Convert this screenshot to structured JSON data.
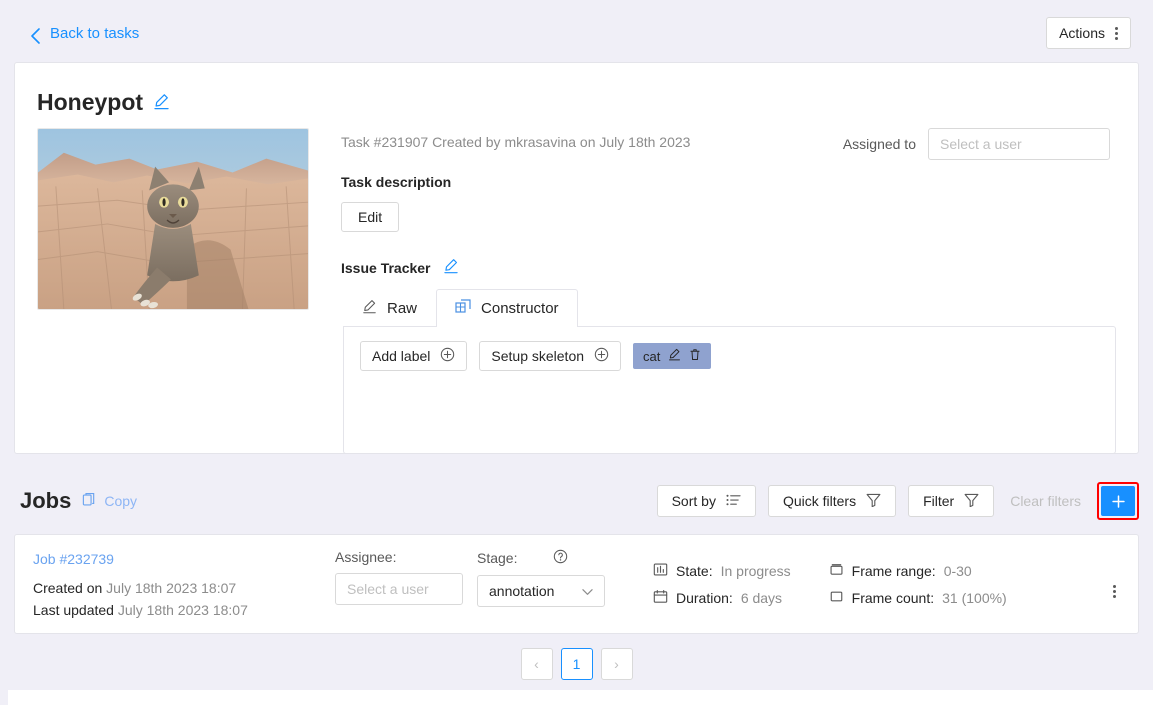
{
  "topbar": {
    "back_label": "Back to tasks",
    "actions_label": "Actions"
  },
  "task": {
    "title": "Honeypot",
    "meta": "Task #231907 Created by mkrasavina on July 18th 2023",
    "description_section": "Task description",
    "edit_label": "Edit",
    "issue_tracker_section": "Issue Tracker",
    "assigned_label": "Assigned to",
    "assignee_placeholder": "Select a user",
    "preview_alt": "cat-in-desert-thumbnail"
  },
  "tracker": {
    "tabs": [
      {
        "label": "Raw",
        "icon": "pencil-icon",
        "active": false
      },
      {
        "label": "Constructor",
        "icon": "constructor-grid-icon",
        "active": true
      }
    ],
    "add_label": "Add label",
    "setup_skeleton": "Setup skeleton",
    "labels": [
      {
        "name": "cat",
        "color": "#8fa2cf"
      }
    ]
  },
  "jobs": {
    "title": "Jobs",
    "copy_label": "Copy",
    "sort_by": "Sort by",
    "quick_filters": "Quick filters",
    "filter": "Filter",
    "clear_filters": "Clear filters",
    "add_job_label": "+",
    "highlight_color": "#ff0000",
    "accent_color": "#1890ff",
    "rows": [
      {
        "job_link": "Job #232739",
        "created_label": "Created on",
        "created_value": "July 18th 2023 18:07",
        "updated_label": "Last updated",
        "updated_value": "July 18th 2023 18:07",
        "assignee_label": "Assignee:",
        "assignee_placeholder": "Select a user",
        "stage_label": "Stage:",
        "stage_value": "annotation",
        "state_label": "State:",
        "state_value": "In progress",
        "duration_label": "Duration:",
        "duration_value": "6 days",
        "frame_range_label": "Frame range:",
        "frame_range_value": "0-30",
        "frame_count_label": "Frame count:",
        "frame_count_value": "31 (100%)"
      }
    ]
  },
  "pagination": {
    "prev": "‹",
    "current": "1",
    "next": "›"
  }
}
